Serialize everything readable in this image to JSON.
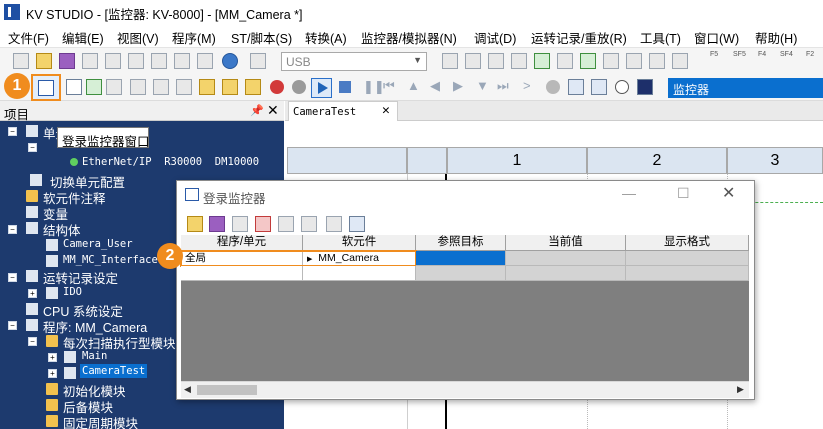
{
  "window": {
    "title": "KV STUDIO - [监控器: KV-8000] - [MM_Camera *]"
  },
  "menu": [
    "文件(F)",
    "编辑(E)",
    "视图(V)",
    "程序(M)",
    "ST/脚本(S)",
    "转换(A)",
    "监控器/模拟器(N)",
    "调试(D)",
    "运转记录/重放(R)",
    "工具(T)",
    "窗口(W)",
    "帮助(H)"
  ],
  "toolbar": {
    "connection": "USB",
    "mode": "监控器",
    "fkeys": [
      "F5",
      "SF5",
      "F4",
      "SF4",
      "F2"
    ]
  },
  "left_panel": {
    "title": "项目",
    "tooltip": "登录监控器窗口",
    "tree": {
      "unit_config": "单元配置",
      "ethernet": "EtherNet/IP",
      "ethernet_addr": "R30000",
      "ethernet_dm": "DM10000",
      "switch_unit": "切换单元配置",
      "device_comment": "软元件注释",
      "variable": "变量",
      "struct": "结构体",
      "camera_user": "Camera_User",
      "mm_mc_interface": "MM_MC_Interface",
      "op_record": "运转记录设定",
      "ido": "IDO",
      "cpu_setting": "CPU 系统设定",
      "program": "程序: MM_Camera",
      "scan_module": "每次扫描执行型模块",
      "main": "Main",
      "camera_test": "CameraTest",
      "init_module": "初始化模块",
      "standby_module": "后备模块",
      "fixed_module": "固定周期模块"
    }
  },
  "editor": {
    "tab": "CameraTest",
    "columns": [
      "1",
      "2",
      "3"
    ]
  },
  "dialog": {
    "title": "登录监控器",
    "headers": [
      "程序/单元",
      "软元件",
      "参照目标",
      "当前值",
      "显示格式"
    ],
    "row": {
      "program": "全局",
      "device": "MM_Camera"
    }
  },
  "badges": [
    "1",
    "2"
  ],
  "colors": {
    "accent": "#f08c1e",
    "tree_bg": "#1d3a6e",
    "selection": "#0a6fcf"
  }
}
